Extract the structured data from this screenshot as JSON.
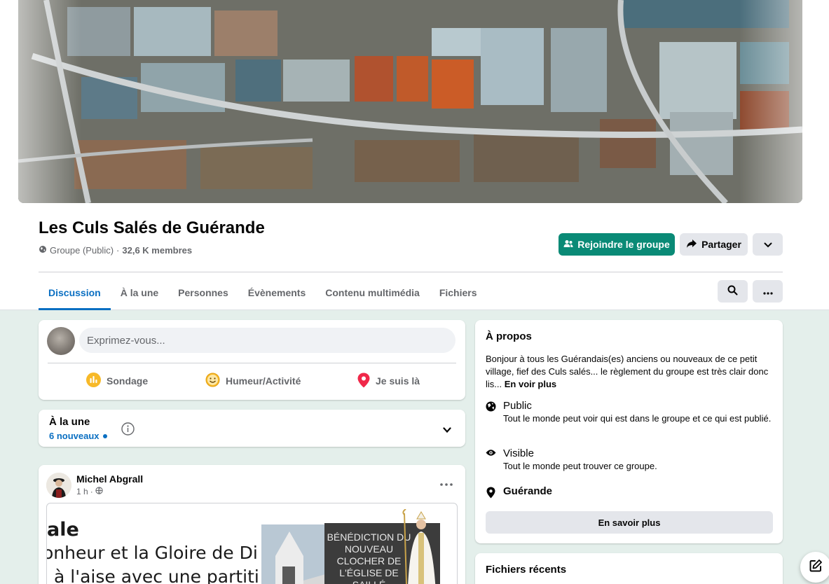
{
  "group": {
    "name": "Les Culs Salés de Guérande",
    "privacy": "Groupe (Public)",
    "separator": "·",
    "members": "32,6 K membres"
  },
  "actions": {
    "join_label": "Rejoindre le groupe",
    "share_label": "Partager"
  },
  "tabs": [
    {
      "label": "Discussion",
      "active": true
    },
    {
      "label": "À la une"
    },
    {
      "label": "Personnes"
    },
    {
      "label": "Évènements"
    },
    {
      "label": "Contenu multimédia"
    },
    {
      "label": "Fichiers"
    }
  ],
  "composer": {
    "placeholder": "Exprimez-vous...",
    "actions": [
      {
        "label": "Sondage",
        "icon": "poll-icon",
        "color": "#f7b928"
      },
      {
        "label": "Humeur/Activité",
        "icon": "smiley-icon",
        "color": "#f7b928"
      },
      {
        "label": "Je suis là",
        "icon": "location-pin-icon",
        "color": "#f02849"
      }
    ]
  },
  "featured": {
    "title": "À la une",
    "new_count": "6 nouveaux"
  },
  "post": {
    "author": "Michel Abgrall",
    "time": "1 h",
    "image_text": {
      "line1": "ale",
      "line2": "onheur et la Gloire de Di",
      "line3": "à l'aise avec une partiti",
      "banner": "BÉNÉDICTION DU NOUVEAU CLOCHER DE L'ÉGLISE DE SAILLÉ"
    }
  },
  "about": {
    "title": "À propos",
    "description": "Bonjour à tous les Guérandais(es) anciens ou nouveaux de ce petit village, fief des Culs salés... le règlement du groupe est très clair donc lis...",
    "see_more": "En voir plus",
    "public_title": "Public",
    "public_text": "Tout le monde peut voir qui est dans le groupe et ce qui est publié.",
    "visible_title": "Visible",
    "visible_text": "Tout le monde peut trouver ce groupe.",
    "location": "Guérande",
    "learn_more": "En savoir plus"
  },
  "recent_files": {
    "title": "Fichiers récents"
  },
  "colors": {
    "accent": "#0a8a76",
    "link_blue": "#0a6fc2",
    "page_bg": "#e4efeb"
  }
}
